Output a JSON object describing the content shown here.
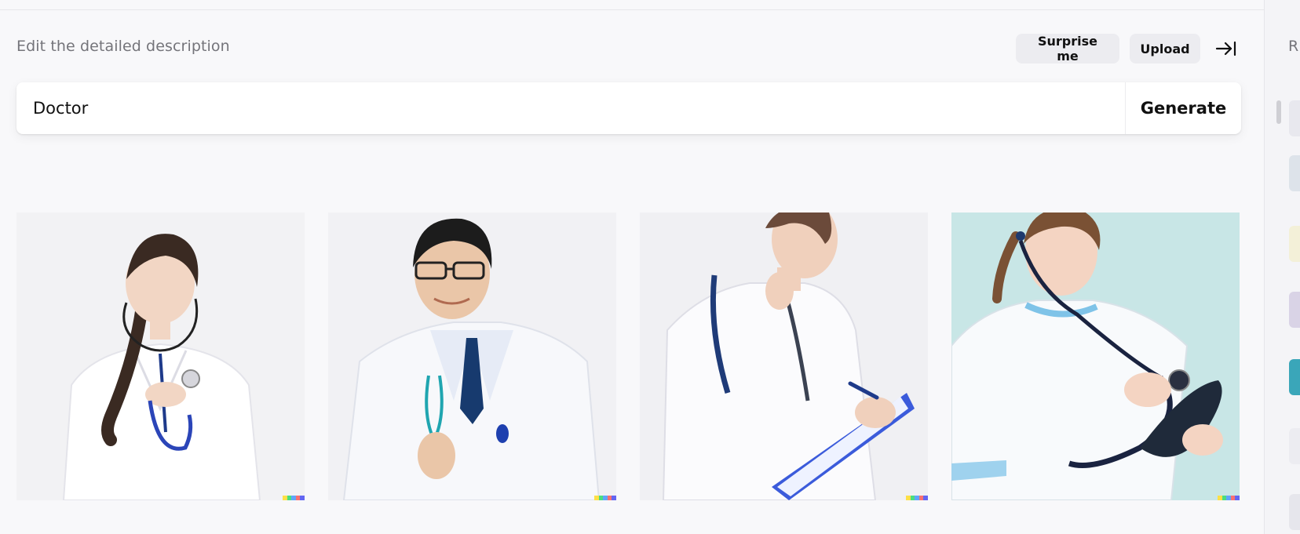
{
  "header": {
    "hint": "Edit the detailed description",
    "surprise_label": "Surprise me",
    "upload_label": "Upload",
    "collapse_icon": "arrow-right-to-bar-icon"
  },
  "prompt": {
    "value": "Doctor",
    "generate_label": "Generate"
  },
  "results": [
    {
      "subject": "female doctor with stethoscope",
      "background": "#f2f2f4"
    },
    {
      "subject": "male doctor with glasses and tie",
      "background": "#f1f1f4"
    },
    {
      "subject": "female doctor writing on clipboard",
      "background": "#f0f0f3"
    },
    {
      "subject": "nurse examining with stethoscope",
      "background": "#c8e6e6"
    }
  ],
  "sidebar": {
    "title_fragment": "R"
  },
  "colors": {
    "accent": "#111111",
    "page": "#f8f8fa",
    "pill": "#ececf0"
  }
}
